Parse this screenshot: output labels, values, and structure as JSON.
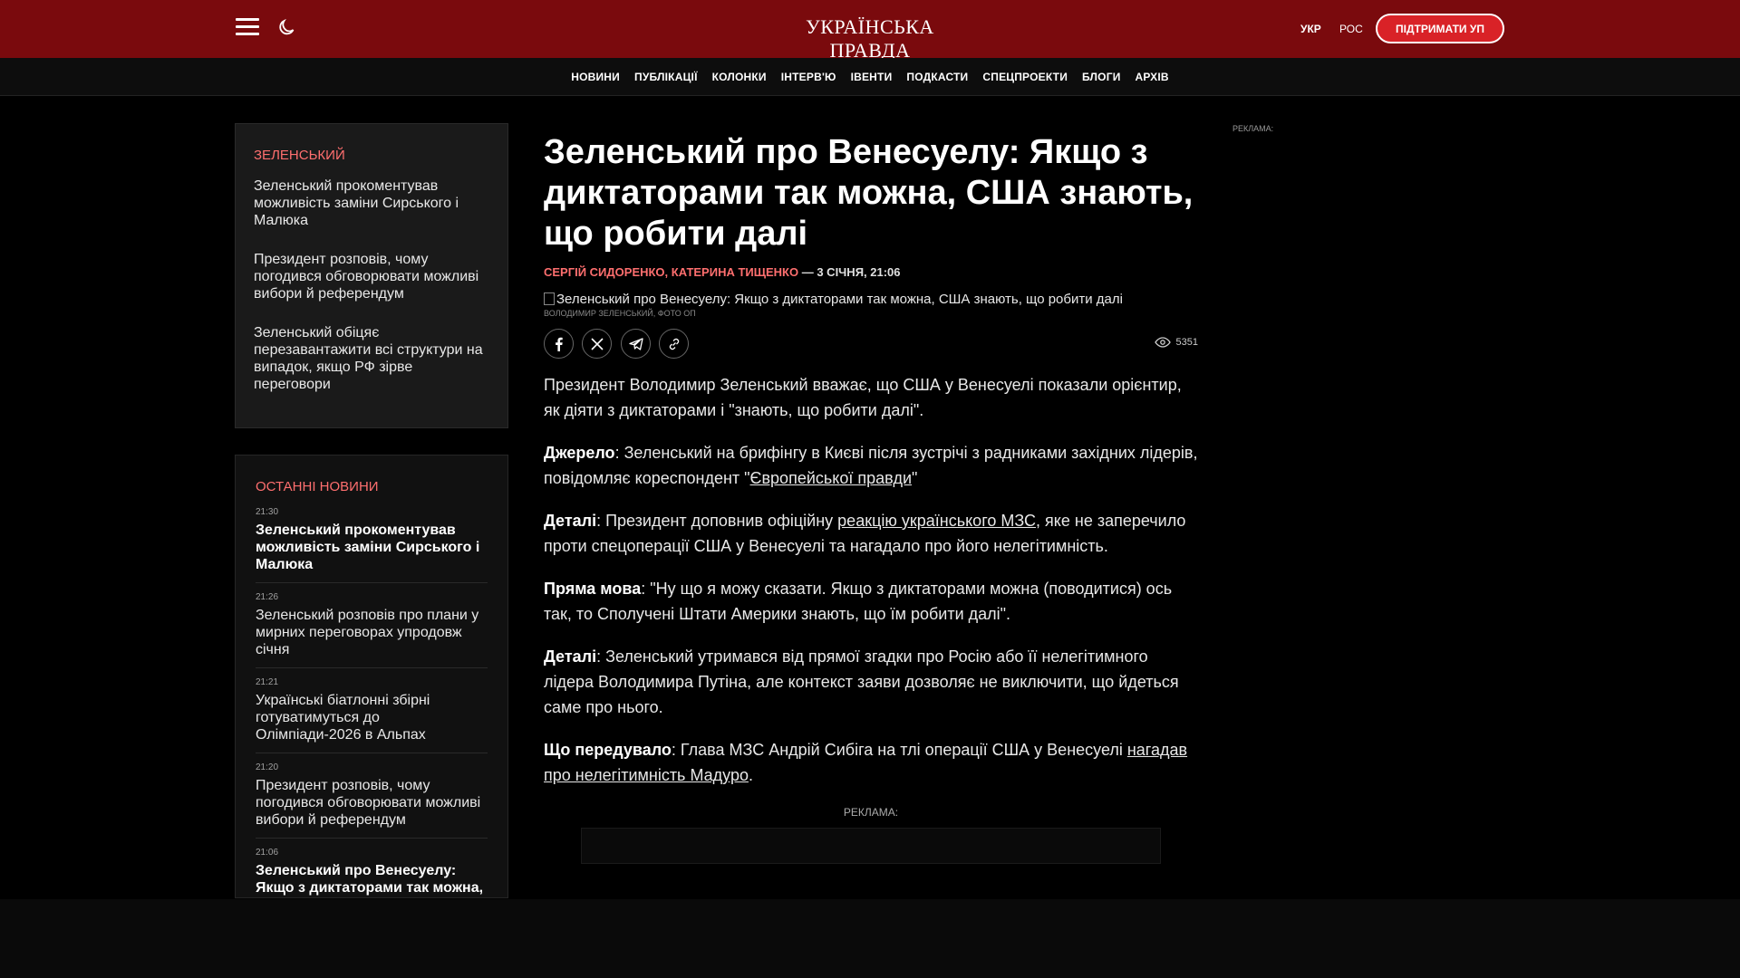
{
  "header": {
    "logo": "УКРАЇНСЬКА ПРАВДА",
    "lang_ukr": "УКР",
    "lang_ros": "РОС",
    "support_label": "ПІДТРИМАТИ УП",
    "bg_color": "#7a0a0d"
  },
  "nav": {
    "items": [
      "НОВИНИ",
      "ПУБЛІКАЦІЇ",
      "КОЛОНКИ",
      "ІНТЕРВ'Ю",
      "ІВЕНТИ",
      "ПОДКАСТИ",
      "СПЕЦПРОЕКТИ",
      "БЛОГИ",
      "АРХІВ"
    ]
  },
  "sidebar": {
    "tag": "ЗЕЛЕНСЬКИЙ",
    "links": [
      "Зеленський прокоментував можливість заміни Сирського і Малюка",
      "Президент розповів, чому погодився обговорювати можливі вибори й референдум",
      "Зеленський обіцяє перезавантажити всі структури на випадок, якщо РФ зірве переговори"
    ]
  },
  "latest": {
    "heading": "ОСТАННІ НОВИНИ",
    "items": [
      {
        "time": "21:30",
        "title": "Зеленський прокоментував можливість заміни Сирського і Малюка"
      },
      {
        "time": "21:26",
        "title": "Зеленський розповів про плани у мирних переговорах упродовж січня"
      },
      {
        "time": "21:21",
        "title": "Українські біатлонні збірні готуватимуться до Олімпіади-2026 в Альпах"
      },
      {
        "time": "21:20",
        "title": "Президент розповів, чому погодився обговорювати можливі вибори й референдум"
      },
      {
        "time": "21:06",
        "title": "Зеленський про Венесуелу: Якщо з диктаторами так можна, США знають, що робити далі"
      }
    ]
  },
  "article": {
    "title": "Зеленський про Венесуелу: Якщо з диктаторами так можна, США знають, що робити далі",
    "authors": "СЕРГІЙ СИДОРЕНКО, КАТЕРИНА ТИЩЕНКО",
    "date": " — 3 СІЧНЯ, 21:06",
    "image_alt": "Зеленський про Венесуелу: Якщо з диктаторами так можна, США знають, що робити далі",
    "image_caption": "ВОЛОДИМИР ЗЕЛЕНСЬКИЙ, ФОТО ОП",
    "views": "5351",
    "p1": "Президент Володимир Зеленський вважає, що США у Венесуелі показали орієнтир, як діяти з диктаторами і \"знають, що робити далі\".",
    "p2_label": "Джерело",
    "p2_text": ": Зеленський на брифінгу в Києві після зустрічі з радниками західних лідерів, повідомляє кореспондент \"",
    "p2_link": "Європейської правди",
    "p2_end": "\"",
    "p3_label": "Деталі",
    "p3_text": ": Президент доповнив офіційну ",
    "p3_link": "реакцію українського МЗС",
    "p3_end": ", яке не заперечило проти спецоперації США у Венесуелі та нагадало про його нелегітимність.",
    "p4_label": "Пряма мова",
    "p4_text": ": \"Ну що я можу сказати. Якщо з диктаторами можна (поводитися) ось так, то Сполучені Штати Америки знають, що їм робити далі\".",
    "p5_label": "Деталі",
    "p5_text": ": Зеленський утримався від прямої згадки про Росію або її нелегітимного лідера Володимира Путіна, але контекст заяви дозволяє не виключити, що йдеться саме про нього.",
    "p6_label": "Що передувало",
    "p6_text": ": Глава МЗС Андрій Сибіга на тлі операції США у Венесуелі ",
    "p6_link": "нагадав про нелегітимність Мадуро",
    "p6_end": ".",
    "ad_label": "РЕКЛАМА:"
  },
  "right_ad_label": "РЕКЛАМА:"
}
